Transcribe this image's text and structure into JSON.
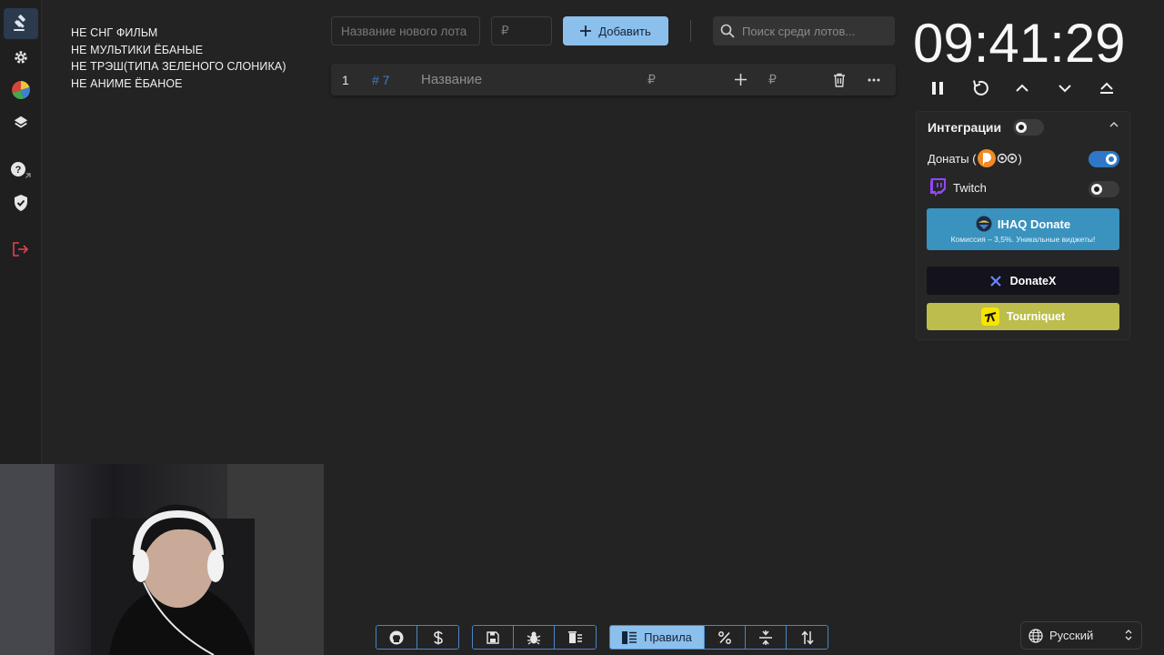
{
  "rules": {
    "lines": [
      "НЕ СНГ ФИЛЬМ",
      "НЕ МУЛЬТИКИ ЁБАНЫЕ",
      "НЕ ТРЭШ(ТИПА ЗЕЛЕНОГО СЛОНИКА)",
      "НЕ АНИМЕ ЁБАНОЕ"
    ]
  },
  "toolbar": {
    "lot_name_placeholder": "Название нового лота",
    "amount_placeholder": "₽",
    "add_label": "Добавить",
    "search_placeholder": "Поиск среди лотов..."
  },
  "lots": [
    {
      "index": "1",
      "id": "# 7",
      "name_placeholder": "Название",
      "amount_placeholder": "₽",
      "add_amount_placeholder": "₽"
    }
  ],
  "timer": {
    "display": "09:41:29"
  },
  "integrations": {
    "title": "Интеграции",
    "enabled": false,
    "donations_label_prefix": "Донаты (",
    "donations_label_suffix": ")",
    "donations_enabled": true,
    "twitch_label": "Twitch",
    "twitch_enabled": false,
    "ihaq": {
      "title": "IHAQ Donate",
      "subtitle": "Комиссия – 3,5%. Уникальные виджеты!"
    },
    "donatex": {
      "title": "DonateX"
    },
    "tourniquet": {
      "title": "Tourniquet"
    }
  },
  "bottom": {
    "rules_label": "Правила"
  },
  "language": {
    "selected": "Русский"
  },
  "colors": {
    "accent": "#8cc0ec",
    "toggle_on": "#2f78c8",
    "ihaq_bg": "#3a92be",
    "donatex_bg": "#14121a",
    "tourniquet_bg": "#bcbd4c",
    "twitch": "#9146ff",
    "logout": "#e0434f"
  }
}
